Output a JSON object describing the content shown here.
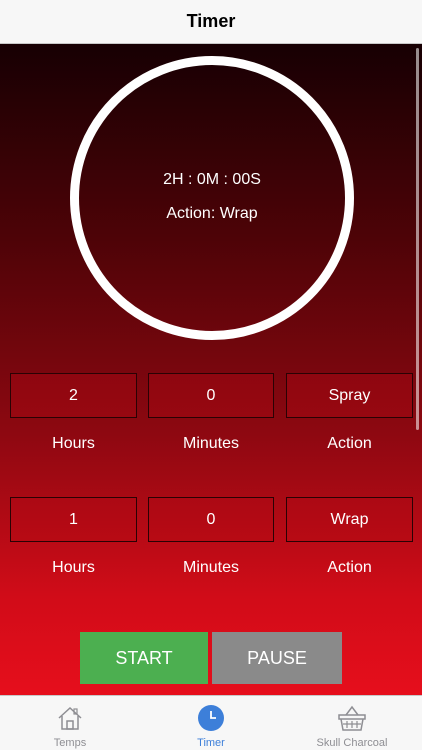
{
  "navbar": {
    "title": "Timer"
  },
  "timer": {
    "countdown": "2H : 0M : 00S",
    "action_text": "Action: Wrap"
  },
  "rows": [
    {
      "hours_value": "2",
      "minutes_value": "0",
      "action_value": "Spray",
      "hours_label": "Hours",
      "minutes_label": "Minutes",
      "action_label": "Action"
    },
    {
      "hours_value": "1",
      "minutes_value": "0",
      "action_value": "Wrap",
      "hours_label": "Hours",
      "minutes_label": "Minutes",
      "action_label": "Action"
    }
  ],
  "controls": {
    "start_label": "START",
    "pause_label": "PAUSE"
  },
  "tabs": [
    {
      "label": "Temps",
      "icon": "house-icon"
    },
    {
      "label": "Timer",
      "icon": "clock-icon",
      "active": true
    },
    {
      "label": "Skull Charcoal",
      "icon": "basket-icon"
    }
  ],
  "colors": {
    "start": "#4caf50",
    "pause": "#8a8a8a",
    "active_tab": "#3d7fd9",
    "gradient_top": "#170003",
    "gradient_bottom": "#e60e1c"
  }
}
